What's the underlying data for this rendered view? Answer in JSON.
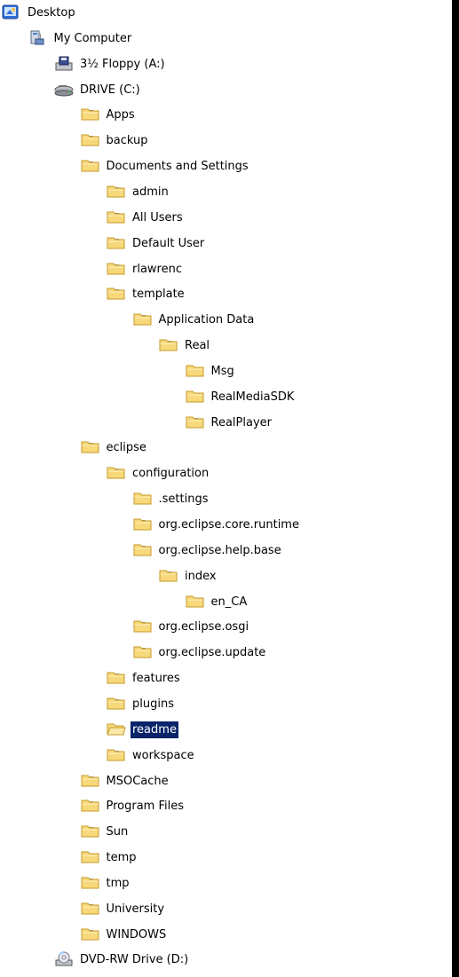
{
  "tree": {
    "nodes": [
      {
        "label": "Desktop",
        "icon": "desktop-icon",
        "depth": 0,
        "expander": "none"
      },
      {
        "label": "My Computer",
        "icon": "my-computer-icon",
        "depth": 1,
        "expander": "minus"
      },
      {
        "label": "3½ Floppy (A:)",
        "icon": "floppy-drive-icon",
        "depth": 2,
        "expander": "plus"
      },
      {
        "label": "DRIVE (C:)",
        "icon": "hard-drive-icon",
        "depth": 2,
        "expander": "minus"
      },
      {
        "label": "Apps",
        "icon": "folder-icon",
        "depth": 3,
        "expander": "plus"
      },
      {
        "label": "backup",
        "icon": "folder-icon",
        "depth": 3,
        "expander": "plus"
      },
      {
        "label": "Documents and Settings",
        "icon": "folder-icon",
        "depth": 3,
        "expander": "minus"
      },
      {
        "label": "admin",
        "icon": "folder-icon",
        "depth": 4,
        "expander": "plus"
      },
      {
        "label": "All Users",
        "icon": "folder-icon",
        "depth": 4,
        "expander": "plus"
      },
      {
        "label": "Default User",
        "icon": "folder-icon",
        "depth": 4,
        "expander": "plus"
      },
      {
        "label": "rlawrenc",
        "icon": "folder-icon",
        "depth": 4,
        "expander": "plus"
      },
      {
        "label": "template",
        "icon": "folder-icon",
        "depth": 4,
        "expander": "minus"
      },
      {
        "label": "Application Data",
        "icon": "folder-icon",
        "depth": 5,
        "expander": "minus"
      },
      {
        "label": "Real",
        "icon": "folder-icon",
        "depth": 6,
        "expander": "minus"
      },
      {
        "label": "Msg",
        "icon": "folder-icon",
        "depth": 7,
        "expander": "none"
      },
      {
        "label": "RealMediaSDK",
        "icon": "folder-icon",
        "depth": 7,
        "expander": "none"
      },
      {
        "label": "RealPlayer",
        "icon": "folder-icon",
        "depth": 7,
        "expander": "plus"
      },
      {
        "label": "eclipse",
        "icon": "folder-icon",
        "depth": 3,
        "expander": "minus"
      },
      {
        "label": "configuration",
        "icon": "folder-icon",
        "depth": 4,
        "expander": "minus"
      },
      {
        "label": ".settings",
        "icon": "folder-icon",
        "depth": 5,
        "expander": "none"
      },
      {
        "label": "org.eclipse.core.runtime",
        "icon": "folder-icon",
        "depth": 5,
        "expander": "plus"
      },
      {
        "label": "org.eclipse.help.base",
        "icon": "folder-icon",
        "depth": 5,
        "expander": "minus"
      },
      {
        "label": "index",
        "icon": "folder-icon",
        "depth": 6,
        "expander": "minus"
      },
      {
        "label": "en_CA",
        "icon": "folder-icon",
        "depth": 7,
        "expander": "none"
      },
      {
        "label": "org.eclipse.osgi",
        "icon": "folder-icon",
        "depth": 5,
        "expander": "plus"
      },
      {
        "label": "org.eclipse.update",
        "icon": "folder-icon",
        "depth": 5,
        "expander": "plus"
      },
      {
        "label": "features",
        "icon": "folder-icon",
        "depth": 4,
        "expander": "plus"
      },
      {
        "label": "plugins",
        "icon": "folder-icon",
        "depth": 4,
        "expander": "plus"
      },
      {
        "label": "readme",
        "icon": "folder-open-icon",
        "depth": 4,
        "expander": "none",
        "selected": true
      },
      {
        "label": "workspace",
        "icon": "folder-icon",
        "depth": 4,
        "expander": "plus"
      },
      {
        "label": "MSOCache",
        "icon": "folder-icon",
        "depth": 3,
        "expander": "plus"
      },
      {
        "label": "Program Files",
        "icon": "folder-icon",
        "depth": 3,
        "expander": "plus"
      },
      {
        "label": "Sun",
        "icon": "folder-icon",
        "depth": 3,
        "expander": "plus"
      },
      {
        "label": "temp",
        "icon": "folder-icon",
        "depth": 3,
        "expander": "none"
      },
      {
        "label": "tmp",
        "icon": "folder-icon",
        "depth": 3,
        "expander": "plus"
      },
      {
        "label": "University",
        "icon": "folder-icon",
        "depth": 3,
        "expander": "plus"
      },
      {
        "label": "WINDOWS",
        "icon": "folder-icon",
        "depth": 3,
        "expander": "plus"
      },
      {
        "label": "DVD-RW Drive (D:)",
        "icon": "dvd-drive-icon",
        "depth": 2,
        "expander": "plus"
      }
    ]
  },
  "colors": {
    "selection_bg": "#0a246a",
    "selection_text": "#ffffff",
    "folder_fill": "#f7d97b",
    "folder_edge": "#c69a29",
    "panel_bg": "#ffffff",
    "frame": "#000000"
  }
}
